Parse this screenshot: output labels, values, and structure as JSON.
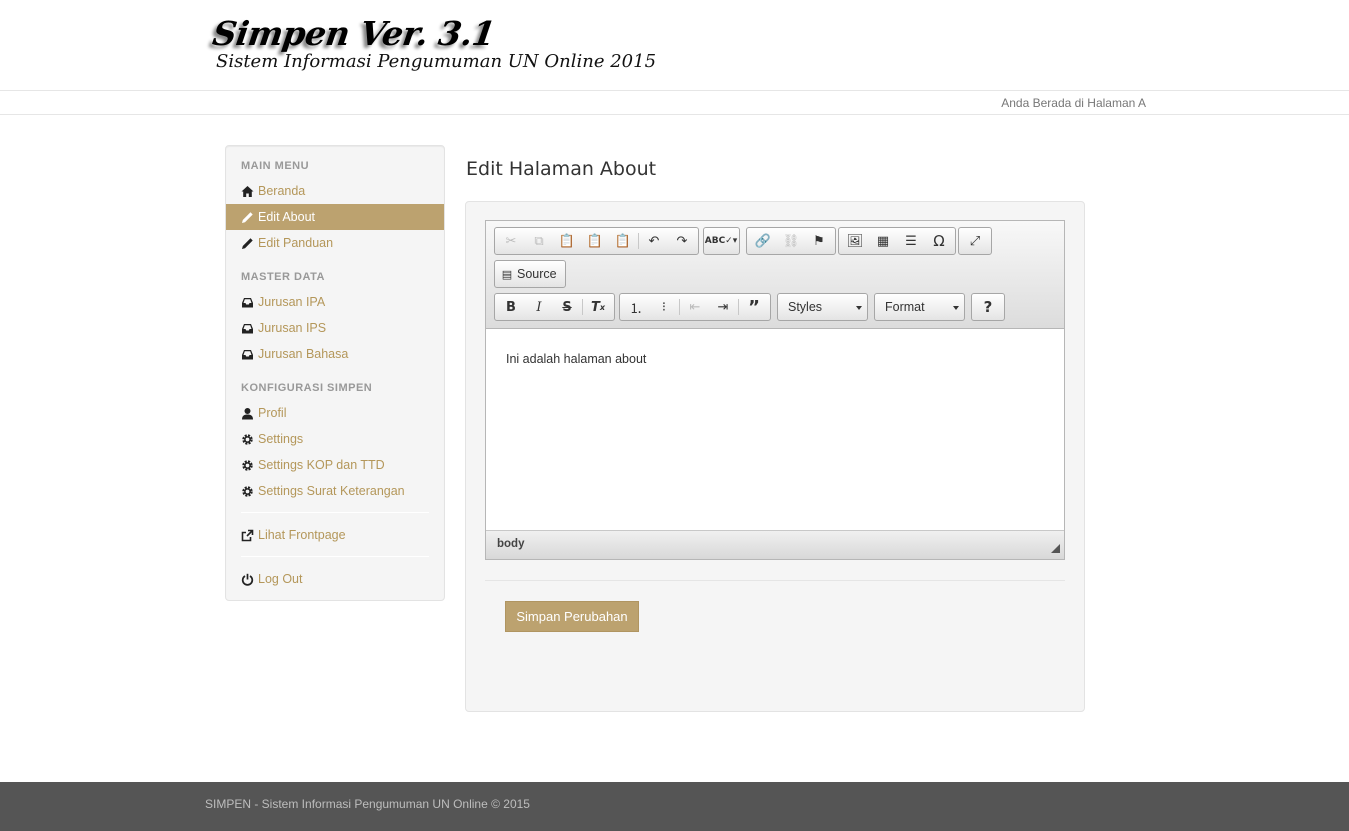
{
  "header": {
    "logo_title": "Simpen Ver. 3.1",
    "logo_subtitle": "Sistem Informasi Pengumuman UN Online 2015",
    "location_text": "Anda Berada di Halaman A"
  },
  "sidebar": {
    "sections": [
      {
        "title": "MAIN MENU"
      },
      {
        "title": "MASTER DATA"
      },
      {
        "title": "KONFIGURASI SIMPEN"
      }
    ],
    "items": [
      {
        "label": "Beranda",
        "icon": "home-icon"
      },
      {
        "label": "Edit About",
        "icon": "pencil-icon",
        "active": true
      },
      {
        "label": "Edit Panduan",
        "icon": "pencil-icon"
      },
      {
        "label": "Jurusan IPA",
        "icon": "inbox-icon"
      },
      {
        "label": "Jurusan IPS",
        "icon": "inbox-icon"
      },
      {
        "label": "Jurusan Bahasa",
        "icon": "inbox-icon"
      },
      {
        "label": "Profil",
        "icon": "user-icon"
      },
      {
        "label": "Settings",
        "icon": "gear-icon"
      },
      {
        "label": "Settings KOP dan TTD",
        "icon": "gear-icon"
      },
      {
        "label": "Settings Surat Keterangan",
        "icon": "gear-icon"
      },
      {
        "label": "Lihat Frontpage",
        "icon": "share-icon"
      },
      {
        "label": "Log Out",
        "icon": "power-icon"
      }
    ]
  },
  "main": {
    "page_title": "Edit Halaman About",
    "editor": {
      "source_label": "Source",
      "styles_label": "Styles",
      "format_label": "Format",
      "content_text": "Ini adalah halaman about",
      "element_path": "body"
    },
    "save_label": "Simpan Perubahan"
  },
  "footer": {
    "text": "SIMPEN - Sistem Informasi Pengumuman UN Online © 2015"
  },
  "colors": {
    "accent": "#bca26f",
    "link": "#b4975a",
    "footer_bg": "#555555"
  }
}
